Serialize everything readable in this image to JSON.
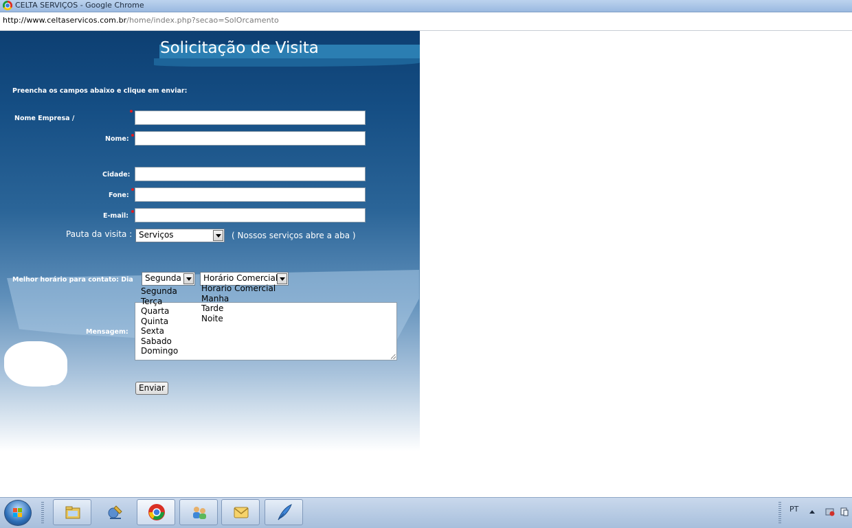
{
  "window": {
    "title": "CELTA SERVIÇOS - Google Chrome"
  },
  "address": {
    "host": "http://www.celtaservicos.com.br",
    "path": "/home/index.php?secao=SolOrcamento"
  },
  "form": {
    "heading": "Solicitação de Visita",
    "instructions": "Preencha os campos abaixo e clique em enviar:",
    "labels": {
      "company": "Nome Empresa /",
      "name": "Nome:",
      "city": "Cidade:",
      "phone": "Fone:",
      "email": "E-mail:",
      "visit_topic": "Pauta da visita :",
      "best_time": "Melhor horário para contato: Dia",
      "message": "Mensagem:"
    },
    "values": {
      "company": "",
      "name": "",
      "city": "",
      "phone": "",
      "email": "",
      "message": ""
    },
    "visit_topic_select": {
      "selected": "Serviços",
      "note": "( Nossos serviços abre a aba )"
    },
    "day_select": {
      "selected": "Segunda",
      "options": [
        "Segunda",
        "Terça",
        "Quarta",
        "Quinta",
        "Sexta",
        "Sabado",
        "Domingo"
      ]
    },
    "period_select": {
      "selected": "Horário Comercial",
      "options": [
        "Horario Comercial",
        "Manha",
        "Tarde",
        "Noite"
      ]
    },
    "submit_label": "Enviar"
  },
  "taskbar": {
    "items": [
      "windows-explorer-icon",
      "network-tool-icon",
      "chrome-icon",
      "contacts-icon",
      "outlook-icon",
      "quill-icon"
    ],
    "language": "PT"
  }
}
